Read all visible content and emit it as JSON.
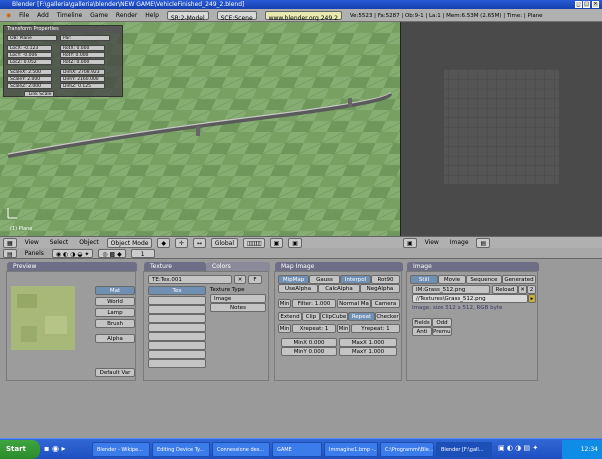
{
  "window_title": "Blender [F:\\galleria\\galleria\\blender\\NEW GAME\\VehicleFinished_249_2.blend]",
  "menu": {
    "items": [
      "File",
      "Add",
      "Timeline",
      "Game",
      "Render",
      "Help"
    ],
    "screen": "SR:2-Model",
    "scene": "SCE:Scene",
    "link": "www.blender.org 249.2",
    "stats": "Ve:5523 | Fa:5287 | Ob:9-1 | La:1 | Mem:6.53M (2.65M) | Time: | Plane"
  },
  "transform": {
    "title": "Transform Properties",
    "ob": "OB: Plane",
    "par": "Par:",
    "locx": "LocX: -0.123",
    "locy": "LocY: -0.006",
    "locz": "LocZ: 0.052",
    "rotx": "RotX: 0.000",
    "roty": "RotY: 0.000",
    "rotz": "RotZ: 0.000",
    "scalex": "ScaleX: 2.500",
    "scaley": "ScaleY: 2.000",
    "scalez": "ScaleZ: 2.000",
    "dimx": "DimX: 2708.923",
    "dimy": "DimY: 2160.000",
    "dimz": "DimZ: 0.125",
    "link_scale": "Link Scale"
  },
  "viewport": {
    "object_label": "(1) Plane"
  },
  "view3d_header": {
    "view": "View",
    "select": "Select",
    "object": "Object",
    "mode": "Object Mode",
    "global": "Global"
  },
  "image_header": {
    "view": "View",
    "image": "Image"
  },
  "buttons_header": {
    "panels": "Panels",
    "frame": "1"
  },
  "preview": {
    "title": "Preview",
    "mat": "Mat",
    "world": "World",
    "lamp": "Lamp",
    "brush": "Brush",
    "alpha": "Alpha",
    "default_var": "Default Var"
  },
  "texture": {
    "tab1": "Texture",
    "tab2": "Colors",
    "name": "TE:Tex.001",
    "f": "F",
    "tex": "Tex",
    "type_label": "Texture Type",
    "type_value": "Image",
    "notes": "Notes"
  },
  "map_image": {
    "title": "Map Image",
    "mipmap": "MipMap",
    "gauss": "Gauss",
    "interpol": "Interpol",
    "rot90": "Rot90",
    "usealpha": "UseAlpha",
    "calcalpha": "CalcAlpha",
    "negalpha": "NegAlpha",
    "min": "Min",
    "filter": "Filter: 1.000",
    "normal_map": "Normal Ma",
    "camera": "Camera",
    "extend": "Extend",
    "clip": "Clip",
    "clipcube": "ClipCube",
    "repeat": "Repeat",
    "checker": "Checker",
    "xrepeat": "Xrepeat: 1",
    "yrepeat": "Yrepeat: 1",
    "minx": "MinX 0.000",
    "maxx": "MaxX 1.000",
    "miny": "MinY 0.000",
    "maxy": "MaxY 1.000"
  },
  "image_panel": {
    "title": "Image",
    "still": "Still",
    "movie": "Movie",
    "sequence": "Sequence",
    "generated": "Generated",
    "im_name": "IM:Grass_512.png",
    "reload": "Reload",
    "users": "2",
    "path": "//Textures\\Grass_512.png",
    "info": "Image: size 512 x 512, RGB byte",
    "fields": "Fields",
    "odd": "Odd",
    "anti": "Anti",
    "premul": "Premul"
  },
  "taskbar": {
    "start": "Start",
    "buttons": [
      "Blender - Wikipe...",
      "Editing Device Ty...",
      "Connessione des...",
      "GAME",
      "Immagine1.bmp -...",
      "C:\\Programmi\\Ble...",
      "Blender [F:\\gall..."
    ],
    "clock": "12:34"
  },
  "colors": {
    "title_bar": "#1a4fc9",
    "viewport_grass": "#7da46a",
    "image_editor_bg": "#4a4a4a",
    "taskbar": "#2a5fcf",
    "panel_tab": "#6e6e86"
  }
}
